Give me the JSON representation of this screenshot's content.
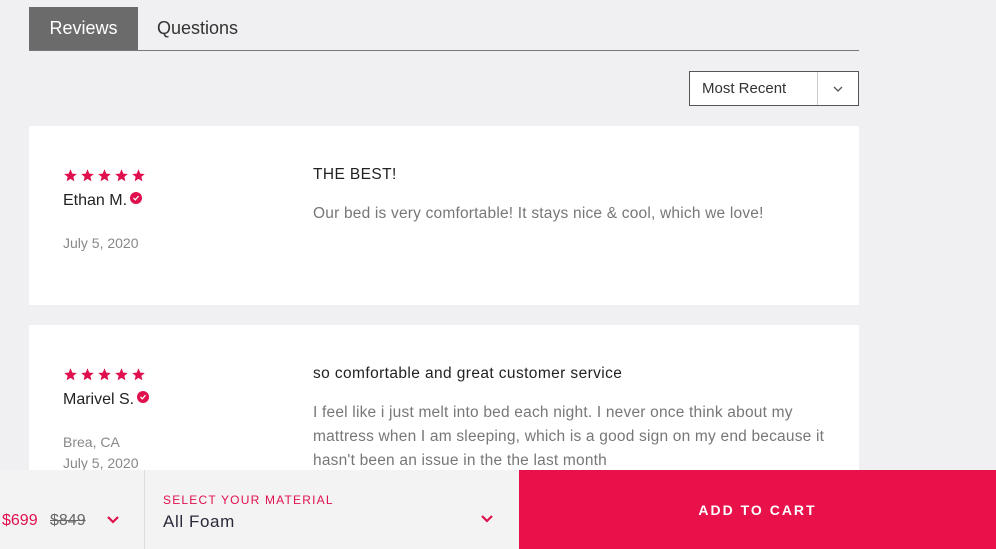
{
  "tabs": [
    {
      "label": "Reviews",
      "active": true
    },
    {
      "label": "Questions",
      "active": false
    }
  ],
  "sort": {
    "selected": "Most Recent"
  },
  "colors": {
    "accent": "#e0104e",
    "cart": "#e8114a",
    "tab_active": "#6b6b6b"
  },
  "reviews": [
    {
      "rating": 5,
      "author": "Ethan M.",
      "verified": true,
      "location": "",
      "date": "July 5, 2020",
      "title": "THE BEST!",
      "body": "Our bed is very comfortable! It stays nice & cool, which we love!"
    },
    {
      "rating": 5,
      "author": "Marivel S.",
      "verified": true,
      "location": "Brea, CA",
      "date": "July 5, 2020",
      "title": "so comfortable and great customer service",
      "body": "I feel like i just melt into bed each night. I never once think about my mattress when I am sleeping, which is a good sign on my end because it hasn't been an issue in the the last month"
    }
  ],
  "bottom_bar": {
    "price_now": "$699",
    "price_was": "$849",
    "material_label": "SELECT YOUR MATERIAL",
    "material_value": "All Foam",
    "add_to_cart": "ADD TO CART"
  }
}
